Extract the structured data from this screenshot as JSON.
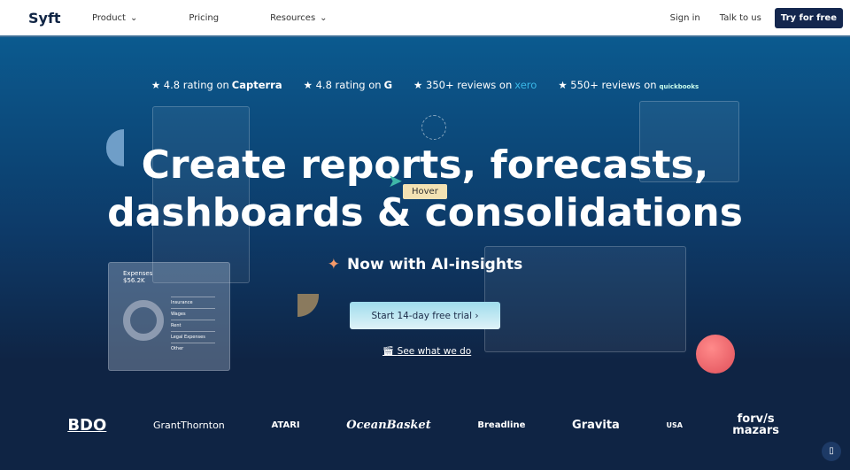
{
  "nav": {
    "logo": "Syft",
    "items": [
      {
        "label": "Product",
        "dropdown": true
      },
      {
        "label": "Pricing",
        "dropdown": false
      },
      {
        "label": "Resources",
        "dropdown": true
      }
    ],
    "sign_in": "Sign in",
    "talk": "Talk to us",
    "try": "Try for free"
  },
  "ratings": [
    {
      "text": "4.8 rating on",
      "brand": "Capterra"
    },
    {
      "text": "4.8 rating on",
      "brand": "G"
    },
    {
      "text": "350+ reviews on",
      "brand": "xero"
    },
    {
      "text": "550+ reviews on",
      "brand": "quickbooks"
    }
  ],
  "hero": {
    "title_line1": "Create reports, forecasts,",
    "title_line2": "dashboards & consolidations",
    "hover": "Hover",
    "ai": "Now with AI-insights",
    "trial": "Start 14-day free trial ›",
    "see": "See what we do"
  },
  "expenses": {
    "title": "Expenses",
    "value": "$56.2K",
    "legend": [
      "Insurance",
      "Wages",
      "Rent",
      "Legal Expenses",
      "Other"
    ]
  },
  "logos": [
    "BDO",
    "GrantThornton",
    "ATARI",
    "OceanBasket",
    "Breadline",
    "Gravita",
    "USA",
    "forv/s mazars"
  ]
}
